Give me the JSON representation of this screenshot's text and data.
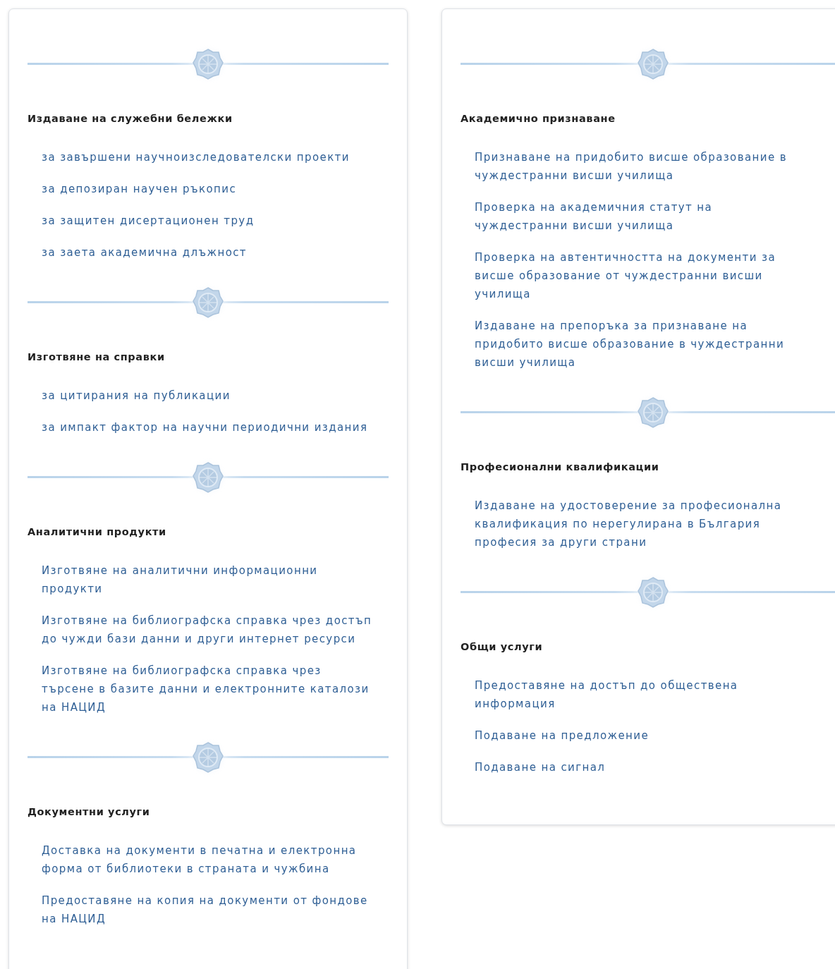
{
  "columns": [
    {
      "sections": [
        {
          "heading": "Издаване на служебни бележки",
          "links": [
            "за завършени научноизследователски проекти",
            "за депозиран научен ръкопис",
            "за защитен дисертационен труд",
            "за заета академична длъжност"
          ]
        },
        {
          "heading": "Изготвяне на справки",
          "links": [
            "за цитирания на публикации",
            "за импакт фактор на научни периодични издания"
          ]
        },
        {
          "heading": "Аналитични продукти",
          "links": [
            "Изготвяне на аналитични информационни продукти",
            "Изготвяне на библиографска справка чрез достъп до чужди бази данни и други интернет ресурси",
            "Изготвяне на библиографска справка чрез търсене в базите данни и електронните каталози на НАЦИД"
          ]
        },
        {
          "heading": "Документни услуги",
          "links": [
            "Доставка на документи в печатна и електронна форма от библиотеки в страната и чужбина",
            "Предоставяне на копия на документи от фондове на НАЦИД"
          ]
        }
      ]
    },
    {
      "sections": [
        {
          "heading": "Академично признаване",
          "links": [
            "Признаване на придобито висше образование в чуждестранни висши училища",
            "Проверка на академичния статут на чуждестранни висши училища",
            "Проверка на автентичността на документи за висше образование от чуждестранни висши училища",
            "Издаване на препоръка за признаване на придобито висше образование в чуждестранни висши училища"
          ]
        },
        {
          "heading": "Професионални квалификации",
          "links": [
            "Издаване на удостоверение за професионална квалификация по нерегулирана в България професия за други страни"
          ]
        },
        {
          "heading": "Общи услуги",
          "links": [
            "Предоставяне на достъп до обществена информация",
            "Подаване на предложение",
            "Подаване на сигнал"
          ]
        }
      ]
    }
  ]
}
